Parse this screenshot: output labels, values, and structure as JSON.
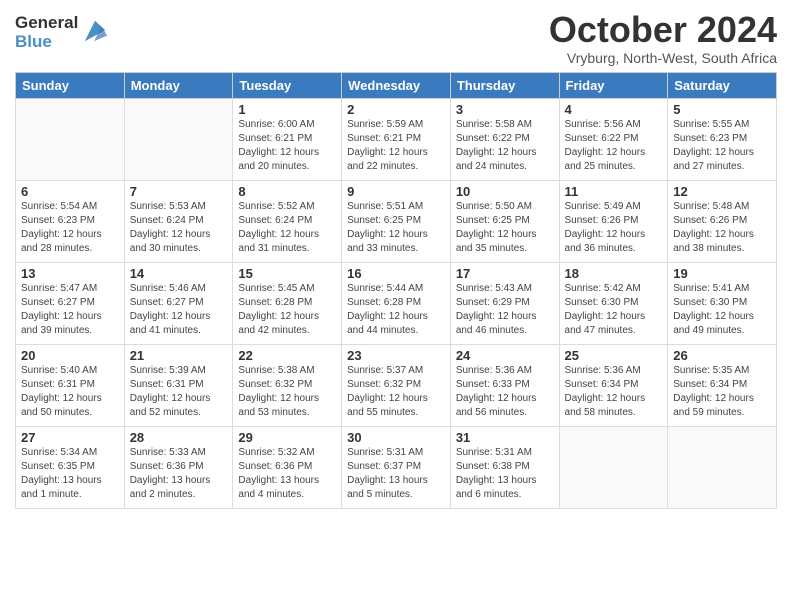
{
  "logo": {
    "line1": "General",
    "line2": "Blue"
  },
  "header": {
    "month": "October 2024",
    "location": "Vryburg, North-West, South Africa"
  },
  "days_of_week": [
    "Sunday",
    "Monday",
    "Tuesday",
    "Wednesday",
    "Thursday",
    "Friday",
    "Saturday"
  ],
  "weeks": [
    [
      {
        "day": "",
        "info": ""
      },
      {
        "day": "",
        "info": ""
      },
      {
        "day": "1",
        "info": "Sunrise: 6:00 AM\nSunset: 6:21 PM\nDaylight: 12 hours\nand 20 minutes."
      },
      {
        "day": "2",
        "info": "Sunrise: 5:59 AM\nSunset: 6:21 PM\nDaylight: 12 hours\nand 22 minutes."
      },
      {
        "day": "3",
        "info": "Sunrise: 5:58 AM\nSunset: 6:22 PM\nDaylight: 12 hours\nand 24 minutes."
      },
      {
        "day": "4",
        "info": "Sunrise: 5:56 AM\nSunset: 6:22 PM\nDaylight: 12 hours\nand 25 minutes."
      },
      {
        "day": "5",
        "info": "Sunrise: 5:55 AM\nSunset: 6:23 PM\nDaylight: 12 hours\nand 27 minutes."
      }
    ],
    [
      {
        "day": "6",
        "info": "Sunrise: 5:54 AM\nSunset: 6:23 PM\nDaylight: 12 hours\nand 28 minutes."
      },
      {
        "day": "7",
        "info": "Sunrise: 5:53 AM\nSunset: 6:24 PM\nDaylight: 12 hours\nand 30 minutes."
      },
      {
        "day": "8",
        "info": "Sunrise: 5:52 AM\nSunset: 6:24 PM\nDaylight: 12 hours\nand 31 minutes."
      },
      {
        "day": "9",
        "info": "Sunrise: 5:51 AM\nSunset: 6:25 PM\nDaylight: 12 hours\nand 33 minutes."
      },
      {
        "day": "10",
        "info": "Sunrise: 5:50 AM\nSunset: 6:25 PM\nDaylight: 12 hours\nand 35 minutes."
      },
      {
        "day": "11",
        "info": "Sunrise: 5:49 AM\nSunset: 6:26 PM\nDaylight: 12 hours\nand 36 minutes."
      },
      {
        "day": "12",
        "info": "Sunrise: 5:48 AM\nSunset: 6:26 PM\nDaylight: 12 hours\nand 38 minutes."
      }
    ],
    [
      {
        "day": "13",
        "info": "Sunrise: 5:47 AM\nSunset: 6:27 PM\nDaylight: 12 hours\nand 39 minutes."
      },
      {
        "day": "14",
        "info": "Sunrise: 5:46 AM\nSunset: 6:27 PM\nDaylight: 12 hours\nand 41 minutes."
      },
      {
        "day": "15",
        "info": "Sunrise: 5:45 AM\nSunset: 6:28 PM\nDaylight: 12 hours\nand 42 minutes."
      },
      {
        "day": "16",
        "info": "Sunrise: 5:44 AM\nSunset: 6:28 PM\nDaylight: 12 hours\nand 44 minutes."
      },
      {
        "day": "17",
        "info": "Sunrise: 5:43 AM\nSunset: 6:29 PM\nDaylight: 12 hours\nand 46 minutes."
      },
      {
        "day": "18",
        "info": "Sunrise: 5:42 AM\nSunset: 6:30 PM\nDaylight: 12 hours\nand 47 minutes."
      },
      {
        "day": "19",
        "info": "Sunrise: 5:41 AM\nSunset: 6:30 PM\nDaylight: 12 hours\nand 49 minutes."
      }
    ],
    [
      {
        "day": "20",
        "info": "Sunrise: 5:40 AM\nSunset: 6:31 PM\nDaylight: 12 hours\nand 50 minutes."
      },
      {
        "day": "21",
        "info": "Sunrise: 5:39 AM\nSunset: 6:31 PM\nDaylight: 12 hours\nand 52 minutes."
      },
      {
        "day": "22",
        "info": "Sunrise: 5:38 AM\nSunset: 6:32 PM\nDaylight: 12 hours\nand 53 minutes."
      },
      {
        "day": "23",
        "info": "Sunrise: 5:37 AM\nSunset: 6:32 PM\nDaylight: 12 hours\nand 55 minutes."
      },
      {
        "day": "24",
        "info": "Sunrise: 5:36 AM\nSunset: 6:33 PM\nDaylight: 12 hours\nand 56 minutes."
      },
      {
        "day": "25",
        "info": "Sunrise: 5:36 AM\nSunset: 6:34 PM\nDaylight: 12 hours\nand 58 minutes."
      },
      {
        "day": "26",
        "info": "Sunrise: 5:35 AM\nSunset: 6:34 PM\nDaylight: 12 hours\nand 59 minutes."
      }
    ],
    [
      {
        "day": "27",
        "info": "Sunrise: 5:34 AM\nSunset: 6:35 PM\nDaylight: 13 hours\nand 1 minute."
      },
      {
        "day": "28",
        "info": "Sunrise: 5:33 AM\nSunset: 6:36 PM\nDaylight: 13 hours\nand 2 minutes."
      },
      {
        "day": "29",
        "info": "Sunrise: 5:32 AM\nSunset: 6:36 PM\nDaylight: 13 hours\nand 4 minutes."
      },
      {
        "day": "30",
        "info": "Sunrise: 5:31 AM\nSunset: 6:37 PM\nDaylight: 13 hours\nand 5 minutes."
      },
      {
        "day": "31",
        "info": "Sunrise: 5:31 AM\nSunset: 6:38 PM\nDaylight: 13 hours\nand 6 minutes."
      },
      {
        "day": "",
        "info": ""
      },
      {
        "day": "",
        "info": ""
      }
    ]
  ]
}
